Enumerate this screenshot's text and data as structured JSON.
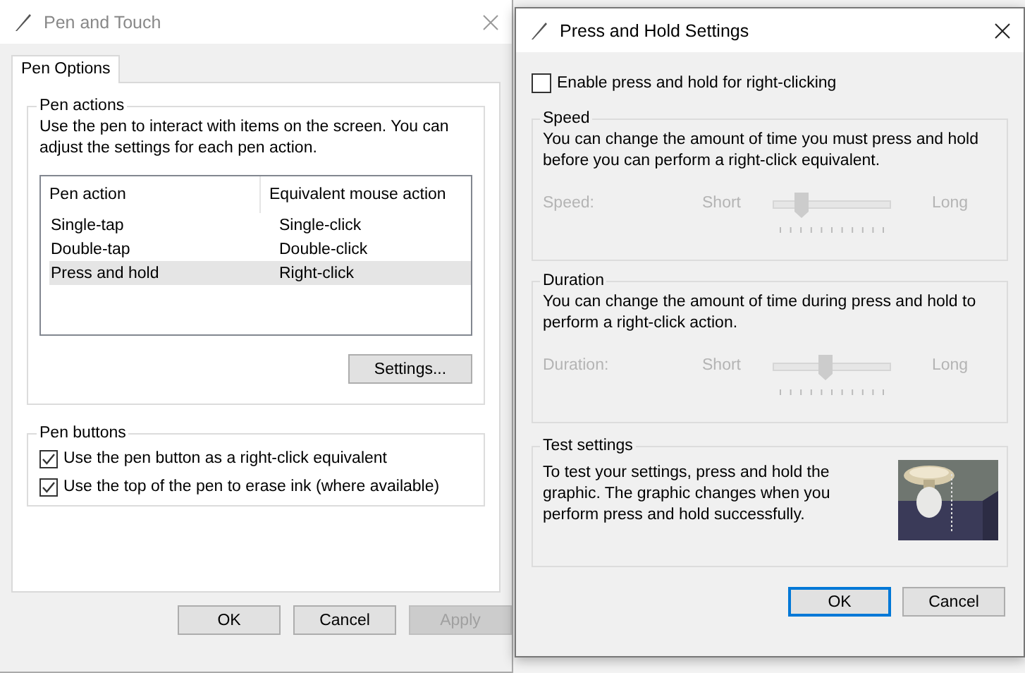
{
  "pen_and_touch": {
    "title": "Pen and Touch",
    "tabs": [
      {
        "label": "Pen Options",
        "selected": true
      }
    ],
    "pen_actions": {
      "legend": "Pen actions",
      "description": "Use the pen to interact with items on the screen.  You can adjust the settings for each pen action.",
      "columns": [
        "Pen action",
        "Equivalent mouse action"
      ],
      "rows": [
        {
          "cells": [
            "Single-tap",
            "Single-click"
          ],
          "selected": false
        },
        {
          "cells": [
            "Double-tap",
            "Double-click"
          ],
          "selected": false
        },
        {
          "cells": [
            "Press and hold",
            "Right-click"
          ],
          "selected": true
        }
      ],
      "settings_button": "Settings..."
    },
    "pen_buttons": {
      "legend": "Pen buttons",
      "options": [
        {
          "label": "Use the pen button as a right-click equivalent",
          "checked": true
        },
        {
          "label": "Use the top of the pen to erase ink (where available)",
          "checked": true
        }
      ]
    },
    "buttons": [
      {
        "label": "OK",
        "disabled": false
      },
      {
        "label": "Cancel",
        "disabled": false
      },
      {
        "label": "Apply",
        "disabled": true
      }
    ]
  },
  "press_and_hold": {
    "title": "Press and Hold Settings",
    "enable": {
      "label": "Enable press and hold for right-clicking",
      "checked": false
    },
    "groups": [
      {
        "kind": "slider",
        "legend": "Speed",
        "description": "You can change the amount of time you must press and hold before you can perform a right-click equivalent.",
        "label": "Speed:",
        "min_label": "Short",
        "max_label": "Long",
        "level": 0.24,
        "disabled": true
      },
      {
        "kind": "slider",
        "legend": "Duration",
        "description": "You can change the amount of time during press and hold to perform a right-click action.",
        "label": "Duration:",
        "min_label": "Short",
        "max_label": "Long",
        "level": 0.45,
        "disabled": true
      },
      {
        "kind": "test",
        "legend": "Test settings",
        "description": "To test your settings, press and hold the graphic. The graphic changes when you perform press and hold successfully."
      }
    ],
    "buttons": [
      {
        "label": "OK",
        "default": true
      },
      {
        "label": "Cancel",
        "default": false
      }
    ]
  }
}
